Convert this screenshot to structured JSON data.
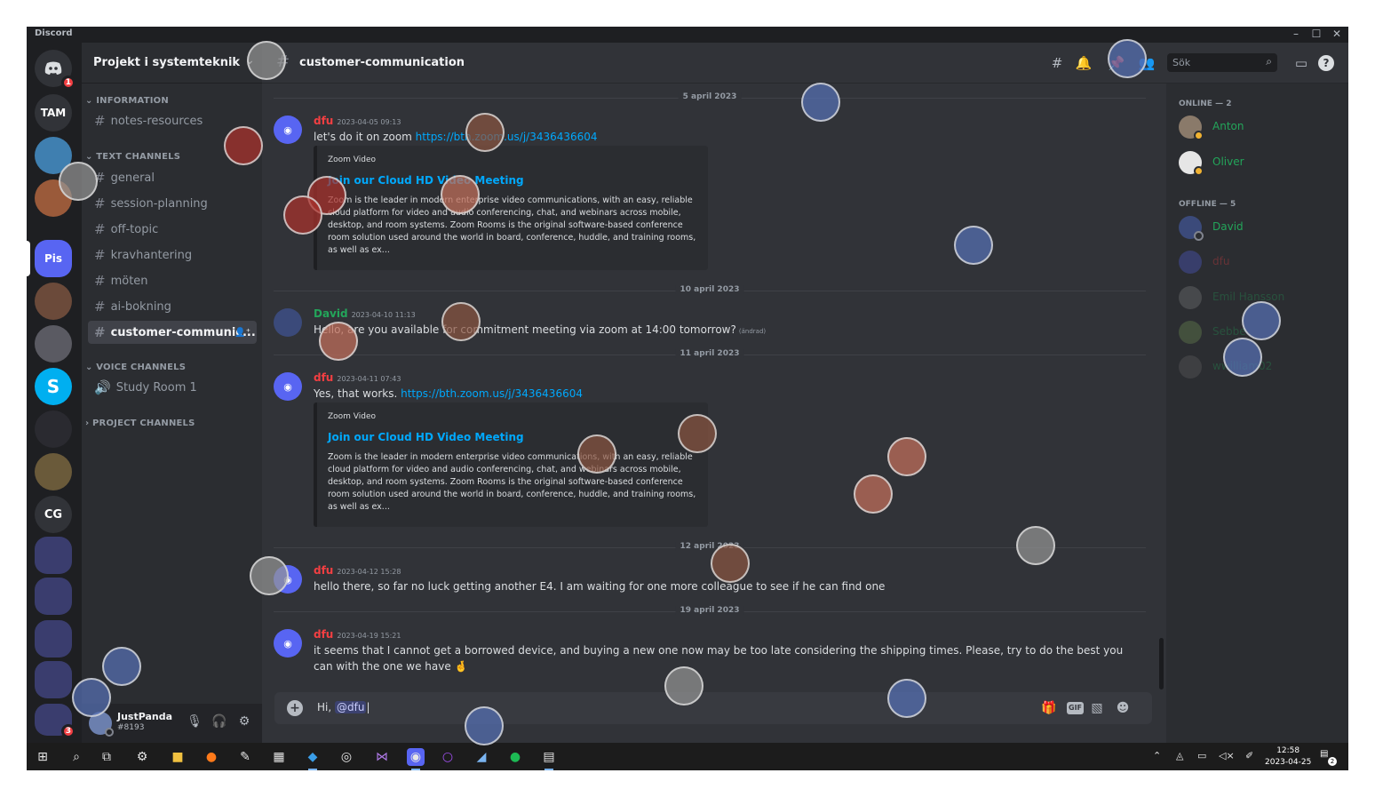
{
  "window": {
    "title": "Discord",
    "controls": [
      "–",
      "☐",
      "✕"
    ]
  },
  "servers": [
    {
      "label": "",
      "kind": "discord-home",
      "badge": "1"
    },
    {
      "label": "TAM"
    },
    {
      "label": "",
      "kind": "avatar"
    },
    {
      "label": "",
      "kind": "avatar"
    },
    {
      "label": "Pis",
      "selected": true
    },
    {
      "label": "",
      "kind": "avatar"
    },
    {
      "label": "",
      "kind": "avatar"
    },
    {
      "label": "S"
    },
    {
      "label": "",
      "kind": "avatar"
    },
    {
      "label": "",
      "kind": "avatar"
    },
    {
      "label": "CG"
    },
    {
      "label": "",
      "kind": "folder"
    },
    {
      "label": "",
      "kind": "folder"
    },
    {
      "label": "",
      "kind": "folder"
    },
    {
      "label": "",
      "kind": "folder"
    },
    {
      "label": "",
      "kind": "folder",
      "badge": "3"
    }
  ],
  "guild": {
    "name": "Projekt i systemteknik"
  },
  "categories": {
    "information": "INFORMATION",
    "text": "TEXT CHANNELS",
    "voice": "VOICE CHANNELS",
    "project": "PROJECT CHANNELS"
  },
  "channels": {
    "info": [
      "notes-resources"
    ],
    "text": [
      "general",
      "session-planning",
      "off-topic",
      "kravhantering",
      "möten",
      "ai-bokning",
      "customer-communic..."
    ],
    "voice": [
      "Study Room 1"
    ]
  },
  "user": {
    "name": "JustPanda",
    "tag": "#8193"
  },
  "header": {
    "channel": "customer-communication",
    "search_placeholder": "Sök"
  },
  "dates": [
    "5 april 2023",
    "10 april 2023",
    "11 april 2023",
    "12 april 2023",
    "19 april 2023"
  ],
  "messages": [
    {
      "author": "dfu",
      "color": "#f23f42",
      "time": "2023-04-05 09:13",
      "text": "let's do it on zoom ",
      "link": "https://bth.zoom.us/j/3436436604",
      "embed": {
        "provider": "Zoom Video",
        "title": "Join our Cloud HD Video Meeting",
        "desc": "Zoom is the leader in modern enterprise video communications, with an easy, reliable cloud platform for video and audio conferencing, chat, and webinars across mobile, desktop, and room systems. Zoom Rooms is the original software-based conference room solution used around the world in board, conference, huddle, and training rooms, as well as ex..."
      }
    },
    {
      "author": "David",
      "color": "#23a55a",
      "time": "2023-04-10 11:13",
      "text": "Hello, are you available for commitment meeting via zoom at 14:00 tomorrow?",
      "edited": "(ändrad)"
    },
    {
      "author": "dfu",
      "color": "#f23f42",
      "time": "2023-04-11 07:43",
      "text": "Yes, that works. ",
      "link": "https://bth.zoom.us/j/3436436604",
      "embed": {
        "provider": "Zoom Video",
        "title": "Join our Cloud HD Video Meeting",
        "desc": "Zoom is the leader in modern enterprise video communications, with an easy, reliable cloud platform for video and audio conferencing, chat, and webinars across mobile, desktop, and room systems. Zoom Rooms is the original software-based conference room solution used around the world in board, conference, huddle, and training rooms, as well as ex..."
      }
    },
    {
      "author": "dfu",
      "color": "#f23f42",
      "time": "2023-04-12 15:28",
      "text": "hello there, so far no luck getting another E4. I am waiting for one more colleague to see if he can find one"
    },
    {
      "author": "dfu",
      "color": "#f23f42",
      "time": "2023-04-19 15:21",
      "text": "it seems that I cannot get a borrowed device, and buying a new one now may be too late considering the shipping times. Please, try to do the best you can with the one we have 🤞"
    }
  ],
  "composer": {
    "prefix": "Hi, ",
    "mention": "@dfu"
  },
  "members": {
    "online_label": "ONLINE — 2",
    "offline_label": "OFFLINE — 5",
    "online": [
      {
        "name": "Anton",
        "color": "#23a55a"
      },
      {
        "name": "Oliver",
        "color": "#23a55a"
      }
    ],
    "offline": [
      {
        "name": "David",
        "color": "#23a55a"
      },
      {
        "name": "dfu",
        "color": "#f23f42"
      },
      {
        "name": "Emil Hansson",
        "color": "#23a55a"
      },
      {
        "name": "Sebbe",
        "color": "#23a55a"
      },
      {
        "name": "wwilliam02",
        "color": "#23a55a"
      }
    ]
  },
  "taskbar": {
    "time": "12:58",
    "date": "2023-04-25",
    "notifications": "2"
  },
  "colors": {
    "blurple": "#5865f2",
    "link": "#00a8fc",
    "bg": "#313338"
  }
}
